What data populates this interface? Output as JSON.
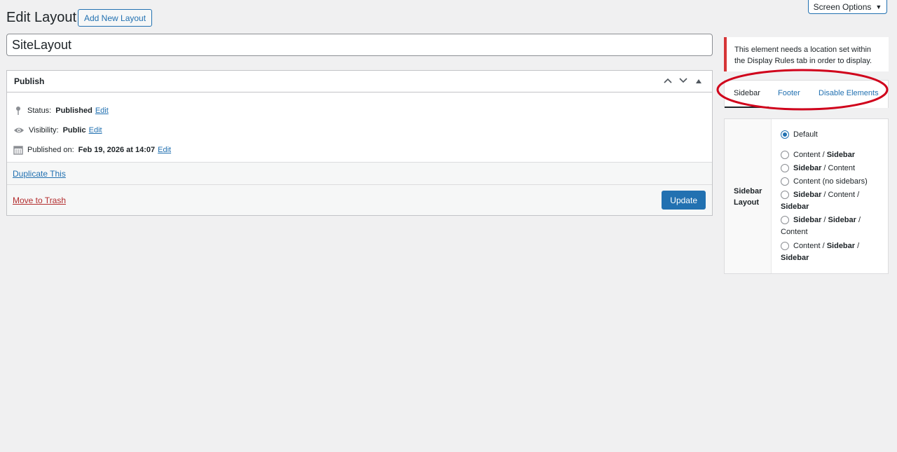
{
  "header": {
    "page_title": "Edit Layout",
    "add_new_label": "Add New Layout",
    "screen_options_label": "Screen Options",
    "screen_options_icon": "triangle-down-icon"
  },
  "title_field": {
    "value": "SiteLayout"
  },
  "publish": {
    "heading": "Publish",
    "status_label": "Status:",
    "status_value": "Published",
    "visibility_label": "Visibility:",
    "visibility_value": "Public",
    "published_on_label": "Published on:",
    "published_on_value": "Feb 19, 2026 at 14:07",
    "edit_link": "Edit",
    "duplicate_link": "Duplicate This",
    "trash_link": "Move to Trash",
    "update_button": "Update"
  },
  "notice": {
    "text": "This element needs a location set within the Display Rules tab in order to display."
  },
  "tabs": [
    {
      "label": "Sidebar",
      "active": true
    },
    {
      "label": "Footer",
      "active": false
    },
    {
      "label": "Disable Elements",
      "active": false
    }
  ],
  "sidebar_layout": {
    "label": "Sidebar Layout",
    "options": [
      {
        "parts": [
          "Default"
        ],
        "bold": [
          false
        ],
        "checked": true
      },
      {
        "parts": [
          "Content",
          " / ",
          "Sidebar"
        ],
        "bold": [
          false,
          false,
          true
        ],
        "checked": false
      },
      {
        "parts": [
          "Sidebar",
          " / ",
          "Content"
        ],
        "bold": [
          true,
          false,
          false
        ],
        "checked": false
      },
      {
        "parts": [
          "Content (no sidebars)"
        ],
        "bold": [
          false
        ],
        "checked": false
      },
      {
        "parts": [
          "Sidebar",
          " / ",
          "Content",
          " / ",
          "Sidebar"
        ],
        "bold": [
          true,
          false,
          false,
          false,
          true
        ],
        "checked": false
      },
      {
        "parts": [
          "Sidebar",
          " / ",
          "Sidebar",
          " / ",
          "Content"
        ],
        "bold": [
          true,
          false,
          true,
          false,
          false
        ],
        "checked": false
      },
      {
        "parts": [
          "Content",
          " / ",
          "Sidebar",
          " / ",
          "Sidebar"
        ],
        "bold": [
          false,
          false,
          true,
          false,
          true
        ],
        "checked": false
      }
    ]
  },
  "colors": {
    "accent": "#2271b1",
    "notice_border": "#d63638",
    "highlight_ring": "#d0021b"
  }
}
